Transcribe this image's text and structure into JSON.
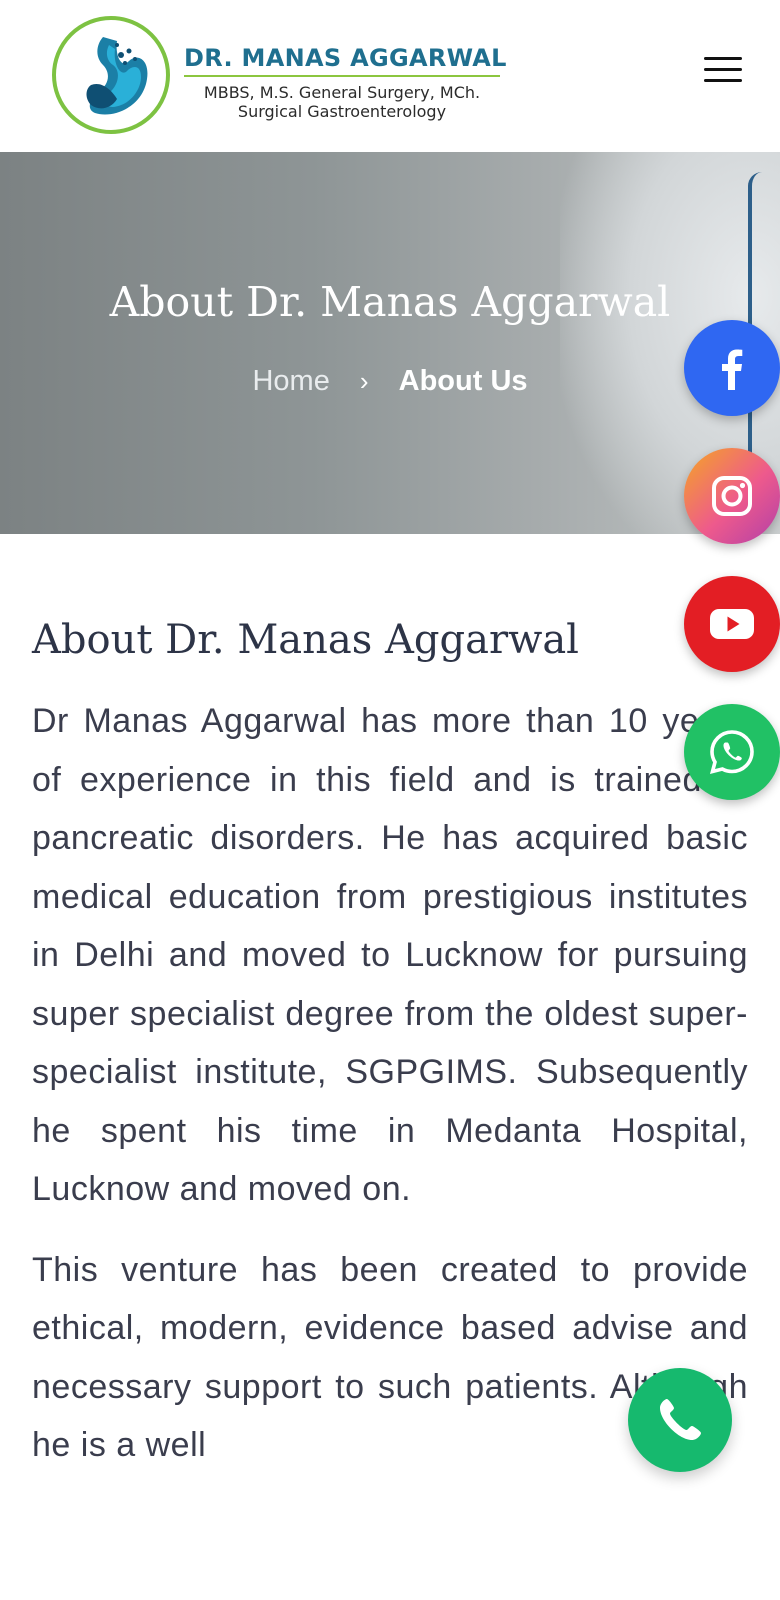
{
  "header": {
    "brand_name": "DR. MANAS AGGARWAL",
    "brand_subtitle_1": "MBBS, M.S. General Surgery, MCh.",
    "brand_subtitle_2": "Surgical Gastroenterology",
    "logo_icon": "stomach-logo-icon",
    "menu_icon": "hamburger-menu-icon"
  },
  "hero": {
    "title": "About Dr. Manas Aggarwal",
    "breadcrumb": {
      "home": "Home",
      "separator": "›",
      "current": "About Us"
    }
  },
  "main": {
    "heading": "About Dr. Manas Aggarwal",
    "paragraphs": [
      "Dr Manas Aggarwal has more than 10 years of experience in this field and is trained in pancreatic disorders. He has acquired basic medical education from prestigious institutes in Delhi and moved to Lucknow for pursuing super specialist degree from the oldest super-specialist institute, SGPGIMS. Subsequently he spent his time in Medanta Hospital, Lucknow and moved on.",
      "This venture has been created to provide ethical, modern, evidence based advise and necessary support to such patients. Although he is a well"
    ]
  },
  "social": [
    {
      "name": "facebook",
      "icon": "facebook-icon",
      "color": "#2f67f2"
    },
    {
      "name": "instagram",
      "icon": "instagram-icon",
      "color": "#ee5a8c"
    },
    {
      "name": "youtube",
      "icon": "youtube-icon",
      "color": "#e31e24"
    },
    {
      "name": "whatsapp",
      "icon": "whatsapp-icon",
      "color": "#21c165"
    }
  ],
  "call_button": {
    "icon": "phone-icon",
    "color": "#16b96e"
  },
  "colors": {
    "brand": "#1f6f8f",
    "accent_line": "#8cc63f",
    "heading": "#2d3447",
    "body_text": "#3a3d4d"
  }
}
